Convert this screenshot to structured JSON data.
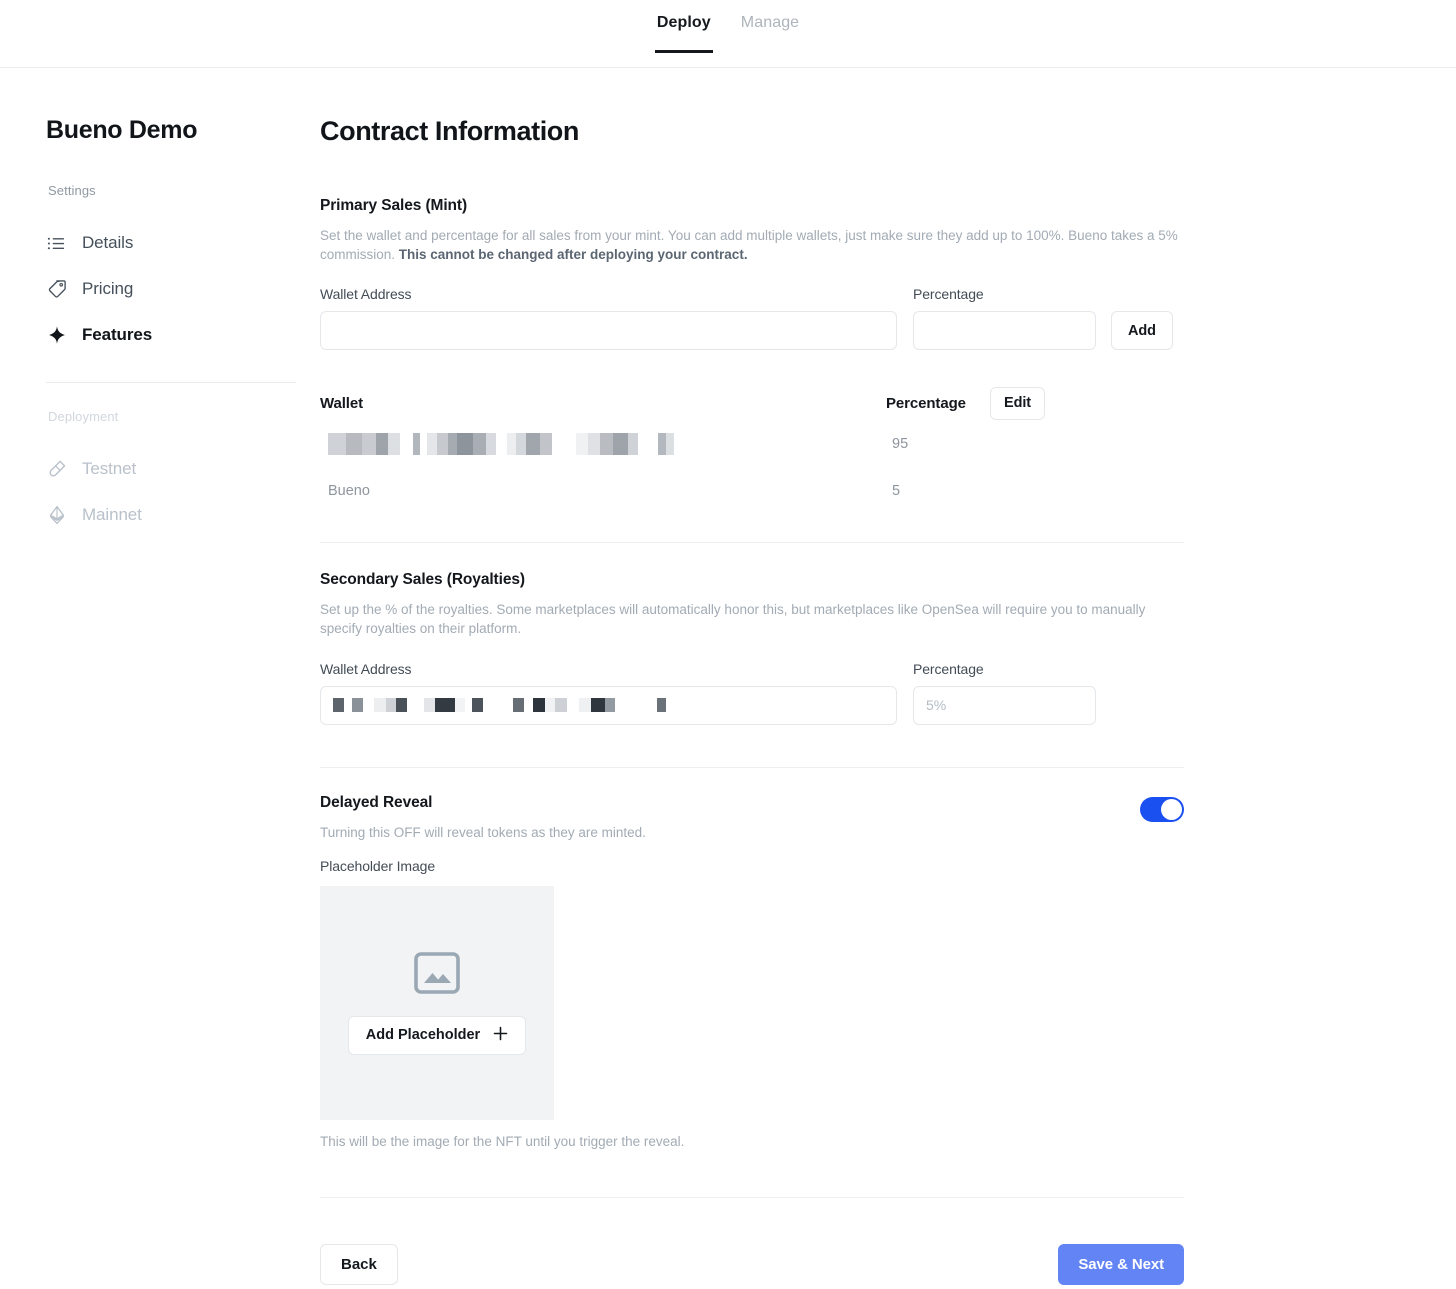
{
  "topnav": {
    "tabs": [
      {
        "label": "Deploy",
        "active": true
      },
      {
        "label": "Manage",
        "active": false
      }
    ]
  },
  "sidebar": {
    "project_title": "Bueno Demo",
    "settings_label": "Settings",
    "settings_items": [
      {
        "label": "Details",
        "icon": "list-icon",
        "active": false
      },
      {
        "label": "Pricing",
        "icon": "tag-icon",
        "active": false
      },
      {
        "label": "Features",
        "icon": "sparkle-icon",
        "active": true
      }
    ],
    "deployment_label": "Deployment",
    "deployment_items": [
      {
        "label": "Testnet",
        "icon": "test-tube-icon",
        "disabled": true
      },
      {
        "label": "Mainnet",
        "icon": "ethereum-icon",
        "disabled": true
      }
    ]
  },
  "main": {
    "page_title": "Contract Information",
    "primary_sales": {
      "title": "Primary Sales (Mint)",
      "description": "Set the wallet and percentage for all sales from your mint. You can add multiple wallets, just make sure they add up to 100%. Bueno takes a 5% commission. ",
      "description_bold": "This cannot be changed after deploying your contract.",
      "wallet_label": "Wallet Address",
      "wallet_value": "",
      "wallet_placeholder": "",
      "percentage_label": "Percentage",
      "percentage_value": "",
      "percentage_placeholder": "",
      "add_button": "Add",
      "table": {
        "headers": [
          "Wallet",
          "Percentage"
        ],
        "edit_button": "Edit",
        "rows": [
          {
            "wallet": "",
            "wallet_redacted": true,
            "percentage": "95"
          },
          {
            "wallet": "Bueno",
            "wallet_redacted": false,
            "percentage": "5"
          }
        ]
      }
    },
    "secondary_sales": {
      "title": "Secondary Sales (Royalties)",
      "description": "Set up the % of the royalties. Some marketplaces will automatically honor this, but marketplaces like OpenSea will require you to manually specify royalties on their platform.",
      "wallet_label": "Wallet Address",
      "wallet_value": "",
      "wallet_redacted": true,
      "percentage_label": "Percentage",
      "percentage_value": "",
      "percentage_placeholder": "5%"
    },
    "delayed_reveal": {
      "title": "Delayed Reveal",
      "description": "Turning this OFF will reveal tokens as they are minted.",
      "toggle_on": true,
      "placeholder_label": "Placeholder Image",
      "add_placeholder_button": "Add Placeholder",
      "add_placeholder_icon": "plus-icon",
      "caption": "This will be the image for the NFT until you trigger the reveal."
    },
    "footer": {
      "back_button": "Back",
      "save_button": "Save & Next"
    }
  },
  "colors": {
    "accent_primary": "#6384f5",
    "toggle_on": "#1b50f0",
    "text_primary": "#111418",
    "text_muted": "#a2abb4",
    "border": "#e5e8eb"
  }
}
